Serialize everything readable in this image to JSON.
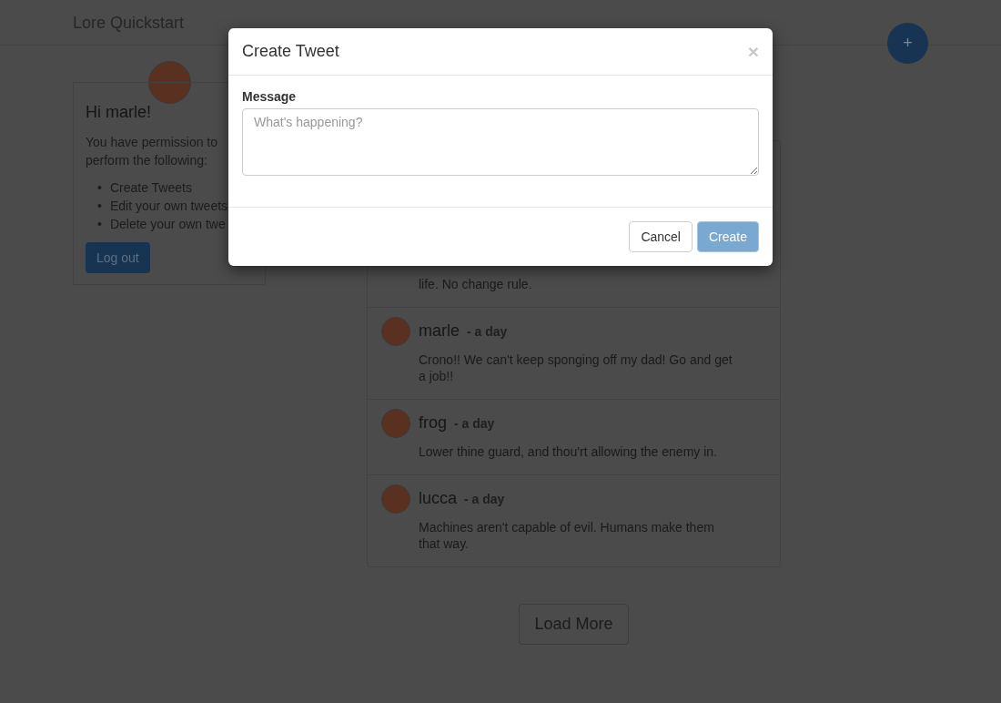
{
  "navbar": {
    "title": "Lore Quickstart",
    "add_button": "+"
  },
  "profile": {
    "greeting": "Hi marle!",
    "intro": "You have permission to perform the following:",
    "bullet": "•",
    "permissions": [
      "Create Tweets",
      "Edit your own tweets",
      "Delete your own twe"
    ],
    "logout_button": "Log out"
  },
  "tweets": [
    {
      "kind": "partial",
      "text": "life. No change rule."
    },
    {
      "kind": "full",
      "user": "marle",
      "time": "- a day",
      "text": "Crono!! We can't keep sponging off my dad! Go and get a job!!"
    },
    {
      "kind": "full",
      "user": "frog",
      "time": "- a day",
      "text": "Lower thine guard, and thou'rt allowing the enemy in."
    },
    {
      "kind": "full",
      "user": "lucca",
      "time": "- a day",
      "text": "Machines aren't capable of evil. Humans make them that way."
    }
  ],
  "load_more_button": "Load More",
  "modal": {
    "title": "Create Tweet",
    "close": "×",
    "label": "Message",
    "placeholder": "What's happening?",
    "buttons": [
      {
        "label": "Cancel",
        "kind": "default",
        "disabled": false
      },
      {
        "label": "Create",
        "kind": "primary",
        "disabled": true
      }
    ]
  }
}
